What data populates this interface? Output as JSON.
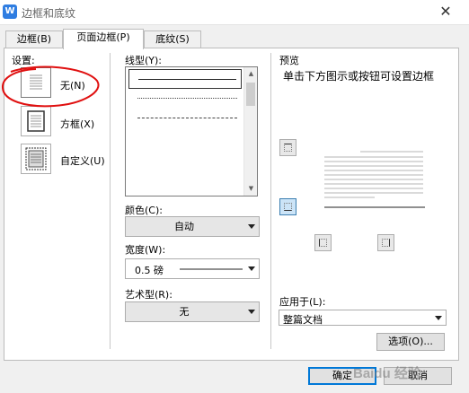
{
  "window": {
    "title": "边框和底纹",
    "app_icon_letter": "W",
    "close_glyph": "✕"
  },
  "tabs": [
    {
      "label": "边框(B)",
      "active": false
    },
    {
      "label": "页面边框(P)",
      "active": true
    },
    {
      "label": "底纹(S)",
      "active": false
    }
  ],
  "settings": {
    "label": "设置:",
    "options": [
      {
        "label": "无(N)",
        "icon": "none-border-icon",
        "selected": true
      },
      {
        "label": "方框(X)",
        "icon": "box-border-icon",
        "selected": false
      },
      {
        "label": "自定义(U)",
        "icon": "custom-border-icon",
        "selected": false
      }
    ]
  },
  "line_style": {
    "label": "线型(Y):",
    "styles": [
      "solid",
      "dotted-fine",
      "dashed-small",
      "dash-dot-small",
      "dashed-medium",
      "dash-dot-medium",
      "dashed-large"
    ]
  },
  "color": {
    "label": "颜色(C):",
    "value": "自动"
  },
  "width": {
    "label": "宽度(W):",
    "value": "0.5  磅"
  },
  "art": {
    "label": "艺术型(R):",
    "value": "无"
  },
  "preview": {
    "label": "预览",
    "hint": "单击下方图示或按钮可设置边框",
    "buttons": [
      "top-border-icon",
      "bottom-border-icon",
      "left-border-icon",
      "right-border-icon"
    ]
  },
  "apply_to": {
    "label": "应用于(L):",
    "value": "整篇文档"
  },
  "options_button": "选项(O)...",
  "ok_button": "确定",
  "cancel_button": "取消",
  "watermark_text": "Baidu 经验",
  "colors": {
    "accent": "#0078d7",
    "annotation": "#e01010",
    "app_icon": "#2f7de1"
  }
}
